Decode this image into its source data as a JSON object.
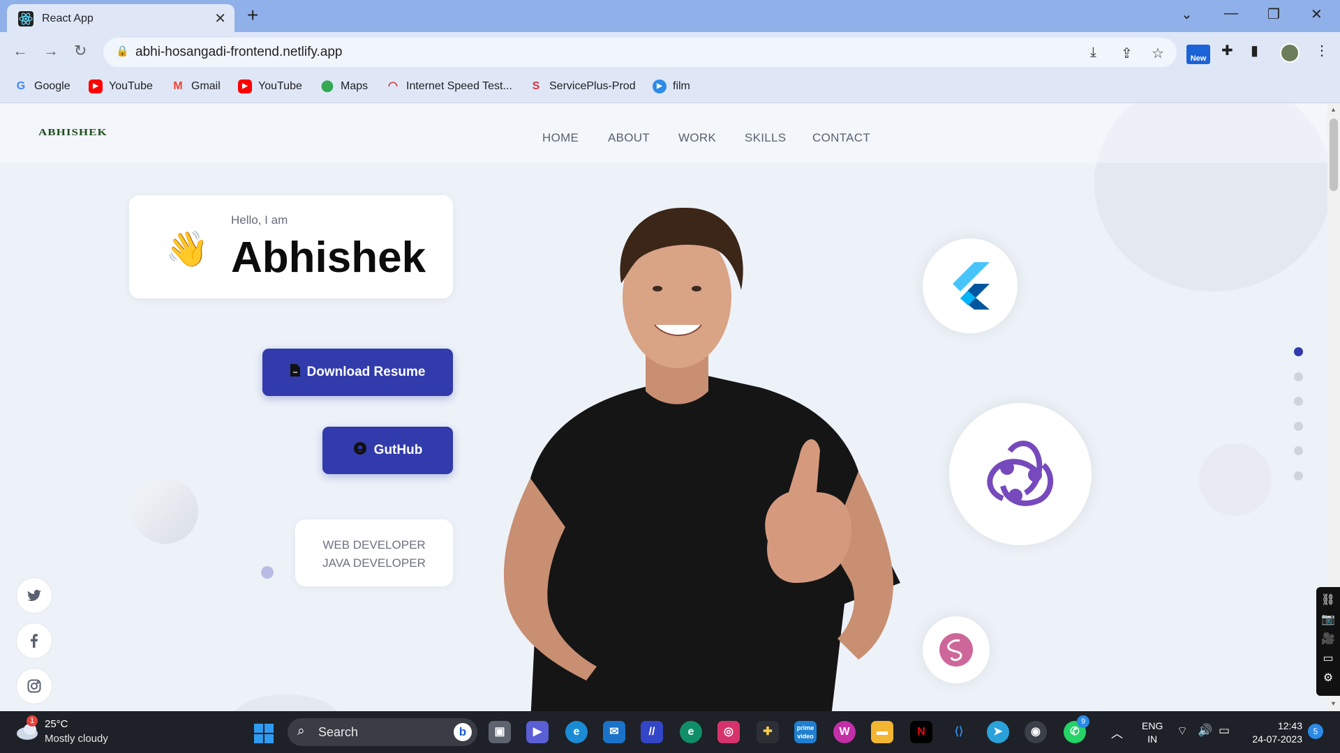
{
  "browser": {
    "tab_title": "React App",
    "url": "abhi-hosangadi-frontend.netlify.app",
    "new_badge": "New",
    "bookmarks": [
      {
        "label": "Google",
        "icon": "google-icon"
      },
      {
        "label": "YouTube",
        "icon": "youtube-icon"
      },
      {
        "label": "Gmail",
        "icon": "gmail-icon"
      },
      {
        "label": "YouTube",
        "icon": "youtube-icon"
      },
      {
        "label": "Maps",
        "icon": "maps-icon"
      },
      {
        "label": "Internet Speed Test...",
        "icon": "speedtest-icon"
      },
      {
        "label": "ServicePlus-Prod",
        "icon": "serviceplus-icon"
      },
      {
        "label": "film",
        "icon": "play-icon"
      }
    ]
  },
  "page": {
    "logo": "ABHISHEK",
    "nav": [
      "HOME",
      "ABOUT",
      "WORK",
      "SKILLS",
      "CONTACT"
    ],
    "hero": {
      "wave_emoji": "👋",
      "greeting": "Hello, I am",
      "name": "Abhishek",
      "download_button": "Download Resume",
      "github_button": "GutHub",
      "roles": [
        "WEB DEVELOPER",
        "JAVA DEVELOPER"
      ]
    },
    "tech_icons": [
      "flutter-icon",
      "redux-icon",
      "sass-icon"
    ],
    "section_dots": 6,
    "active_dot": 0,
    "social": [
      "twitter-icon",
      "facebook-icon",
      "instagram-icon"
    ],
    "accent_color": "#313bac"
  },
  "taskbar": {
    "weather_badge": "1",
    "temperature": "25°C",
    "weather": "Mostly cloudy",
    "search_placeholder": "Search",
    "whatsapp_badge": "9",
    "language": "ENG",
    "region": "IN",
    "time": "12:43",
    "date": "24-07-2023",
    "notifications": "5"
  }
}
